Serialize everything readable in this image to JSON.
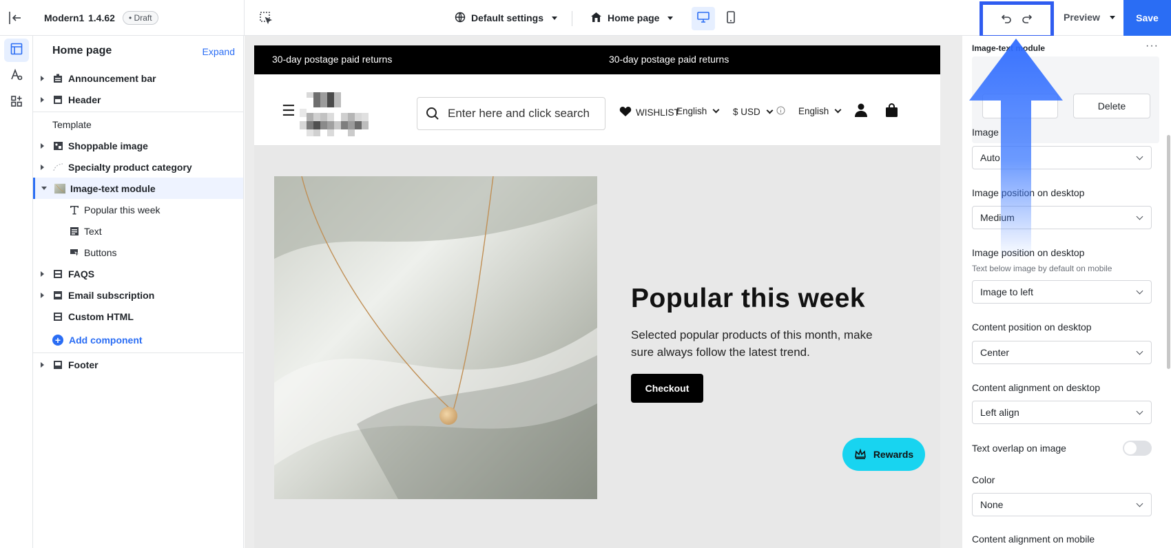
{
  "topbar": {
    "theme_name": "Modern1",
    "theme_version": "1.4.62",
    "draft_label": "• Draft",
    "settings_label": "Default settings",
    "page_label": "Home page",
    "preview_label": "Preview",
    "save_label": "Save"
  },
  "rail": {
    "items": [
      "layout-icon",
      "theme-style-icon",
      "apps-icon"
    ]
  },
  "layers": {
    "title": "Home page",
    "expand_label": "Expand",
    "items": [
      {
        "label": "Announcement bar",
        "icon": "announcement-icon"
      },
      {
        "label": "Header",
        "icon": "header-icon"
      },
      {
        "label": "Template"
      },
      {
        "label": "Shoppable image",
        "icon": "shoppable-image-icon"
      },
      {
        "label": "Specialty product category",
        "icon": "category-icon"
      },
      {
        "label": "Image-text module",
        "icon": "image-thumb-icon"
      },
      {
        "label": "Popular this week",
        "icon": "text-heading-icon"
      },
      {
        "label": "Text",
        "icon": "text-block-icon"
      },
      {
        "label": "Buttons",
        "icon": "button-icon"
      },
      {
        "label": "FAQS",
        "icon": "faq-icon"
      },
      {
        "label": "Email subscription",
        "icon": "email-icon"
      },
      {
        "label": "Custom HTML",
        "icon": "html-icon"
      },
      {
        "label": "Footer",
        "icon": "footer-icon"
      }
    ],
    "add_component_label": "Add component"
  },
  "canvas": {
    "announcement_left": "30-day postage paid returns",
    "announcement_right": "30-day postage paid returns",
    "search_placeholder": "Enter here and click search",
    "wishlist_label": "WISHLIST",
    "language_label": "English",
    "currency_label": "$ USD",
    "language2_label": "English",
    "feature_title": "Popular this week",
    "feature_desc": "Selected popular products of this month, make sure always follow the latest trend.",
    "checkout_label": "Checkout",
    "rewards_label": "Rewards"
  },
  "settings": {
    "title": "Image-text module",
    "more_label": "···",
    "delete_label": "Delete",
    "image_label": "Image",
    "image_value": "Auto",
    "image_pos_label": "Image position on desktop",
    "image_pos_value": "Medium",
    "image_position_label": "Image position on desktop",
    "image_position_help": "Text below image by default on mobile",
    "image_position_value": "Image to left",
    "content_pos_label": "Content position on desktop",
    "content_pos_value": "Center",
    "content_align_label": "Content alignment on desktop",
    "content_align_value": "Left align",
    "overlap_label": "Text overlap on image",
    "overlap_on": false,
    "color_label": "Color",
    "color_value": "None",
    "mobile_align_label": "Content alignment on mobile"
  },
  "colors": {
    "accent": "#2a6df4",
    "highlight_box": "#2f5cf0",
    "rewards": "#18d4f0"
  }
}
